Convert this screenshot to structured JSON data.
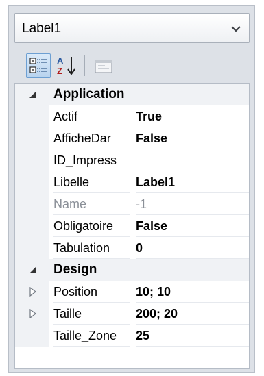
{
  "object_selector": {
    "value": "Label1"
  },
  "toolbar": {
    "categorized_icon": "categorized-view-icon",
    "alphabetical_icon": "alphabetical-sort-icon",
    "pages_icon": "property-pages-icon"
  },
  "categories": [
    {
      "label": "Application",
      "properties": [
        {
          "name": "Actif",
          "value": "True"
        },
        {
          "name": "AfficheDar",
          "value": "False"
        },
        {
          "name": "ID_Impress",
          "value": ""
        },
        {
          "name": "Libelle",
          "value": "Label1"
        },
        {
          "name": "Name",
          "value": "-1"
        },
        {
          "name": "Obligatoire",
          "value": "False"
        },
        {
          "name": "Tabulation",
          "value": "0"
        }
      ]
    },
    {
      "label": "Design",
      "properties": [
        {
          "name": "Position",
          "value": "10; 10"
        },
        {
          "name": "Taille",
          "value": "200; 20"
        },
        {
          "name": "Taille_Zone",
          "value": "25"
        }
      ]
    }
  ],
  "colors": {
    "panel_bg": "#dde1e7",
    "selected_tool": "#b8d3ee",
    "readonly_text": "#8b9098"
  }
}
